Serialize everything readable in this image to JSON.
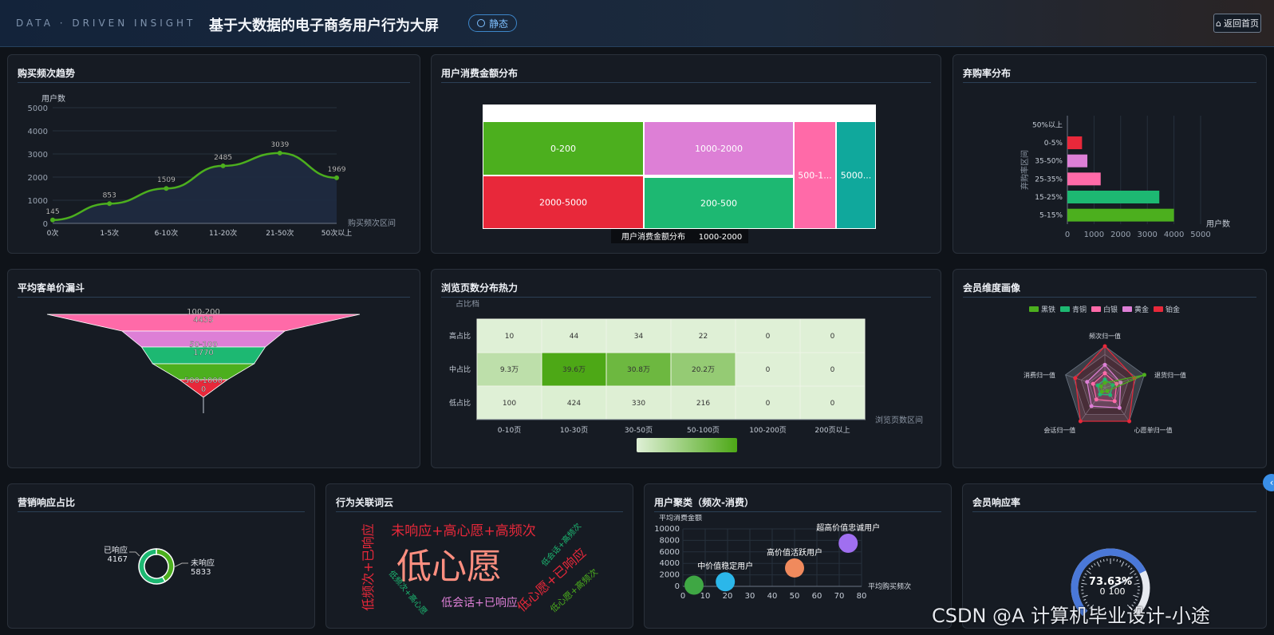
{
  "header": {
    "brand": "DATA · DRIVEN INSIGHT",
    "title": "基于大数据的电子商务用户行为大屏",
    "mode_label": "静态",
    "home_label": "返回首页"
  },
  "panels": {
    "purchase_freq": {
      "title": "购买频次趋势"
    },
    "spend_dist": {
      "title": "用户消费金额分布"
    },
    "abandon": {
      "title": "弃购率分布"
    },
    "funnel": {
      "title": "平均客单价漏斗"
    },
    "heatmap": {
      "title": "浏览页数分布热力"
    },
    "member_radar": {
      "title": "会员维度画像"
    },
    "marketing": {
      "title": "营销响应占比"
    },
    "wordcloud": {
      "title": "行为关联词云"
    },
    "cluster": {
      "title": "用户聚类（频次-消费）"
    },
    "member_resp": {
      "title": "会员响应率"
    }
  },
  "chart_data": [
    {
      "id": "purchase_freq",
      "type": "area",
      "ylabel": "用户数",
      "xlabel": "购买频次区间",
      "categories": [
        "0次",
        "1-5次",
        "6-10次",
        "11-20次",
        "21-50次",
        "50次以上"
      ],
      "values": [
        145,
        853,
        1509,
        2485,
        3039,
        1969
      ],
      "ylim": [
        0,
        5000
      ],
      "yticks": [
        0,
        1000,
        2000,
        3000,
        4000,
        5000
      ],
      "color": "#4caf1e"
    },
    {
      "id": "spend_dist",
      "type": "treemap",
      "tooltip": {
        "name": "用户消费金额分布",
        "value": "1000-2000"
      },
      "cells": [
        {
          "label": "0-200",
          "color": "#4caf1e"
        },
        {
          "label": "1000-2000",
          "color": "#dd7fd6"
        },
        {
          "label": "500-1...",
          "color": "#ff6aa8"
        },
        {
          "label": "5000...",
          "color": "#10a89c"
        },
        {
          "label": "2000-5000",
          "color": "#e8283a"
        },
        {
          "label": "200-500",
          "color": "#1db872"
        }
      ]
    },
    {
      "id": "abandon",
      "type": "bar",
      "orientation": "horizontal",
      "ylabel": "弃购率区间",
      "xlabel": "用户数",
      "categories": [
        "5-15%",
        "15-25%",
        "25-35%",
        "35-50%",
        "0-5%",
        "50%以上"
      ],
      "values": [
        4000,
        3450,
        1250,
        750,
        550,
        0
      ],
      "colors": [
        "#4caf1e",
        "#1db872",
        "#ff6aa8",
        "#dd7fd6",
        "#e8283a",
        "#4caf1e"
      ],
      "xlim": [
        0,
        5000
      ],
      "xticks": [
        0,
        1000,
        2000,
        3000,
        4000,
        5000
      ]
    },
    {
      "id": "funnel",
      "type": "funnel",
      "stages": [
        {
          "name": "100-200",
          "value": "4435",
          "color": "#ff6aa8"
        },
        {
          "name": "",
          "value": "",
          "color": "#dd7fd6"
        },
        {
          "name": "50-100",
          "value": "1770",
          "color": "#1db872"
        },
        {
          "name": "",
          "value": "",
          "color": "#4caf1e"
        },
        {
          "name": "500-1000",
          "value": "0",
          "color": "#e8283a"
        }
      ]
    },
    {
      "id": "heatmap",
      "type": "heatmap",
      "ylabel": "占比档",
      "xlabel": "浏览页数区间",
      "x": [
        "0-10页",
        "10-30页",
        "30-50页",
        "50-100页",
        "100-200页",
        "200页以上"
      ],
      "y": [
        "高占比",
        "中占比",
        "低占比"
      ],
      "cells": [
        [
          "10",
          "44",
          "34",
          "22",
          "0",
          "0"
        ],
        [
          "9.3万",
          "39.6万",
          "30.8万",
          "20.2万",
          "0",
          "0"
        ],
        [
          "100",
          "424",
          "330",
          "216",
          "0",
          "0"
        ]
      ],
      "levels": [
        [
          0,
          0,
          0,
          0,
          0,
          0
        ],
        [
          0.23,
          1,
          0.78,
          0.51,
          0,
          0
        ],
        [
          0,
          0.02,
          0.01,
          0.01,
          0,
          0
        ]
      ]
    },
    {
      "id": "member_radar",
      "type": "radar",
      "legend": [
        {
          "name": "黑铁",
          "color": "#4caf1e"
        },
        {
          "name": "青铜",
          "color": "#1db872"
        },
        {
          "name": "白银",
          "color": "#ff6aa8"
        },
        {
          "name": "黄金",
          "color": "#dd7fd6"
        },
        {
          "name": "铂金",
          "color": "#e8283a"
        }
      ],
      "indicators": [
        "频次归一值",
        "退货归一值",
        "心愿单归一值",
        "会话归一值",
        "消费归一值"
      ]
    },
    {
      "id": "marketing",
      "type": "pie",
      "slices": [
        {
          "name": "已响应",
          "value": 4167,
          "color": "#4caf1e"
        },
        {
          "name": "未响应",
          "value": 5833,
          "color": "#1db872"
        }
      ]
    },
    {
      "id": "wordcloud",
      "type": "wordcloud",
      "words": [
        {
          "text": "低心愿",
          "color": "#ff8f80"
        },
        {
          "text": "未响应+高心愿+高频次",
          "color": "#e8283a"
        },
        {
          "text": "低频次+已响应",
          "color": "#e8283a"
        },
        {
          "text": "低频次+高心愿",
          "color": "#1db872"
        },
        {
          "text": "低会话+已响应",
          "color": "#dd7fd6"
        },
        {
          "text": "低心愿+已响应",
          "color": "#e8283a"
        },
        {
          "text": "低会话+高频次",
          "color": "#1db872"
        },
        {
          "text": "低心愿+高频次",
          "color": "#4caf1e"
        }
      ]
    },
    {
      "id": "cluster",
      "type": "scatter",
      "xlabel": "平均购买频次",
      "ylabel": "平均消费金额",
      "xlim": [
        0,
        80
      ],
      "ylim": [
        0,
        10000
      ],
      "xticks": [
        0,
        10,
        20,
        30,
        40,
        50,
        60,
        70,
        80
      ],
      "yticks": [
        0,
        2000,
        4000,
        6000,
        8000,
        10000
      ],
      "points": [
        {
          "name": "",
          "x": 5,
          "y": 200,
          "color": "#3fa744"
        },
        {
          "name": "中价值稳定用户",
          "x": 19,
          "y": 800,
          "color": "#2bb7ea"
        },
        {
          "name": "高价值活跃用户",
          "x": 50,
          "y": 3200,
          "color": "#f08a5d"
        },
        {
          "name": "超高价值忠诚用户",
          "x": 74,
          "y": 7500,
          "color": "#a06ff0"
        }
      ]
    },
    {
      "id": "member_resp",
      "type": "gauge",
      "value_label": "73.63%",
      "max_label": "100",
      "min_label": "0",
      "fill": 0.736,
      "color": "#4a78d8"
    }
  ],
  "watermark": "CSDN @A 计算机毕业设计-小途"
}
